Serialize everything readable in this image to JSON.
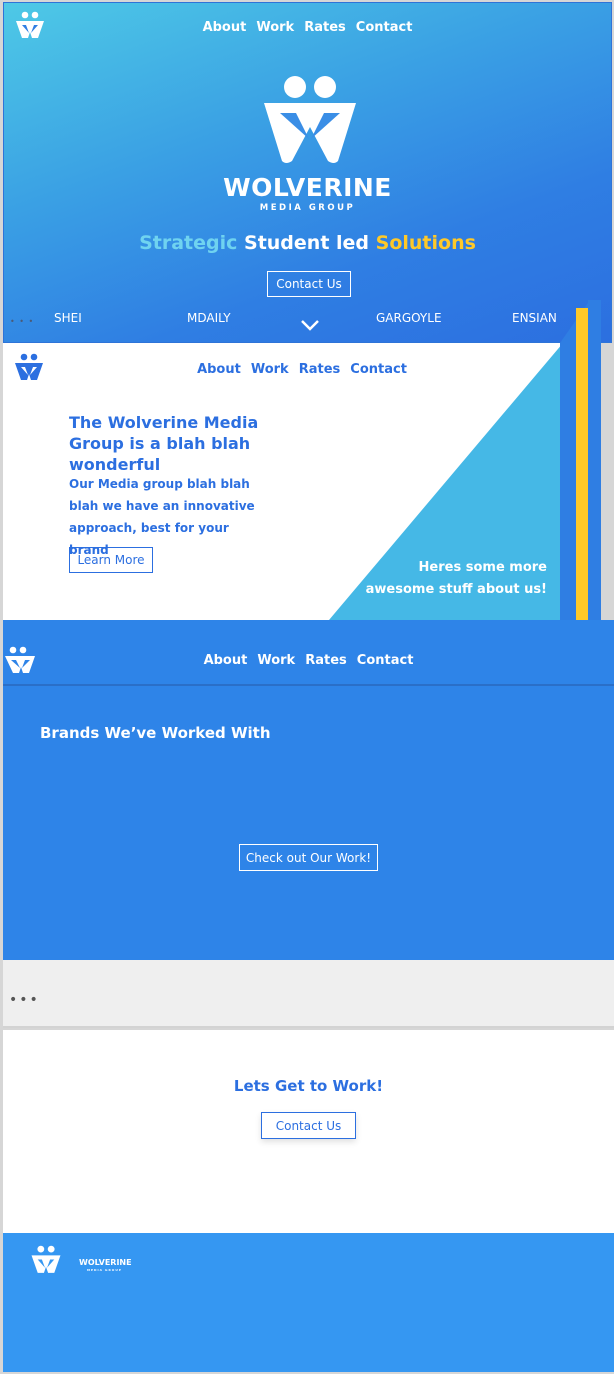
{
  "nav": {
    "about": "About",
    "work": "Work",
    "rates": "Rates",
    "contact": "Contact"
  },
  "hero": {
    "brand_name": "WOLVERINE",
    "brand_sub": "MEDIA GROUP",
    "tagline": {
      "part1": "Strategic",
      "part2": "Student led",
      "part3": "Solutions"
    },
    "cta": "Contact Us",
    "publications": [
      "SHEI",
      "MDAILY",
      "GARGOYLE",
      "ENSIAN"
    ],
    "chevron_icon": "chevron-down-icon"
  },
  "about": {
    "headline": "The Wolverine Media Group is a blah blah wonderful",
    "body": "Our Media group blah blah blah we have an innovative approach, best for your brand",
    "cta": "Learn More",
    "more": "Heres some more awesome stuff about us!"
  },
  "work": {
    "heading": "Brands We’ve Worked With",
    "cta": "Check out Our Work!"
  },
  "contact": {
    "heading": "Lets Get to Work!",
    "cta": "Contact Us"
  },
  "footer": {
    "brand_name": "WOLVERINE",
    "brand_sub": "MEDIA GROUP"
  },
  "colors": {
    "primary_blue": "#2c6fe0",
    "light_blue": "#45b8e6",
    "yellow": "#ffc928",
    "footer_blue": "#3597f2"
  },
  "icons": {
    "logo": "wolverine-logo-icon",
    "chevron": "chevron-down-icon",
    "more": "more-dots-icon"
  }
}
